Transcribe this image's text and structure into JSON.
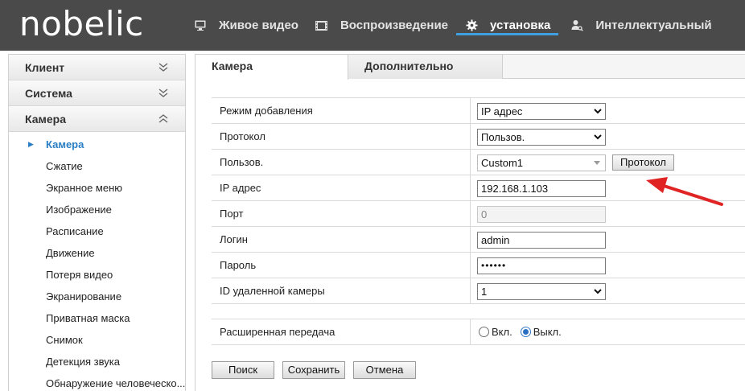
{
  "brand": {
    "logo_text": "nobelic"
  },
  "nav": {
    "items": [
      {
        "label": "Живое видео",
        "icon": "monitor-icon"
      },
      {
        "label": "Воспроизведение",
        "icon": "film-icon"
      },
      {
        "label": "установка",
        "icon": "gear-icon",
        "active": true
      },
      {
        "label": "Интеллектуальный",
        "icon": "user-search-icon"
      }
    ]
  },
  "sidebar": {
    "sections": [
      {
        "label": "Клиент",
        "expanded": false
      },
      {
        "label": "Система",
        "expanded": false
      },
      {
        "label": "Камера",
        "expanded": true
      }
    ],
    "camera_items": [
      "Камера",
      "Сжатие",
      "Экранное меню",
      "Изображение",
      "Расписание",
      "Движение",
      "Потеря видео",
      "Экранирование",
      "Приватная маска",
      "Снимок",
      "Детекция звука",
      "Обнаружение человеческо..."
    ],
    "active_item": "Камера"
  },
  "tabs": [
    {
      "label": "Камера",
      "active": true
    },
    {
      "label": "Дополнительно",
      "active": false
    }
  ],
  "form": {
    "add_mode": {
      "label": "Режим добавления",
      "value": "IP адрес"
    },
    "protocol": {
      "label": "Протокол",
      "value": "Пользов."
    },
    "custom": {
      "label": "Пользов.",
      "value": "Custom1",
      "button": "Протокол"
    },
    "ip": {
      "label": "IP адрес",
      "value": "192.168.1.103"
    },
    "port": {
      "label": "Порт",
      "value": "0"
    },
    "login": {
      "label": "Логин",
      "value": "admin"
    },
    "password": {
      "label": "Пароль",
      "value": "••••••"
    },
    "remote_id": {
      "label": "ID удаленной камеры",
      "value": "1"
    }
  },
  "extended": {
    "label": "Расширенная передача",
    "on_label": "Вкл.",
    "off_label": "Выкл.",
    "selected": "off"
  },
  "actions": {
    "search": "Поиск",
    "save": "Сохранить",
    "cancel": "Отмена"
  },
  "colors": {
    "header_bg": "#4a4a4a",
    "accent": "#3f9fe0",
    "active_link": "#2a7fc4",
    "annotation_arrow": "#e02424"
  }
}
